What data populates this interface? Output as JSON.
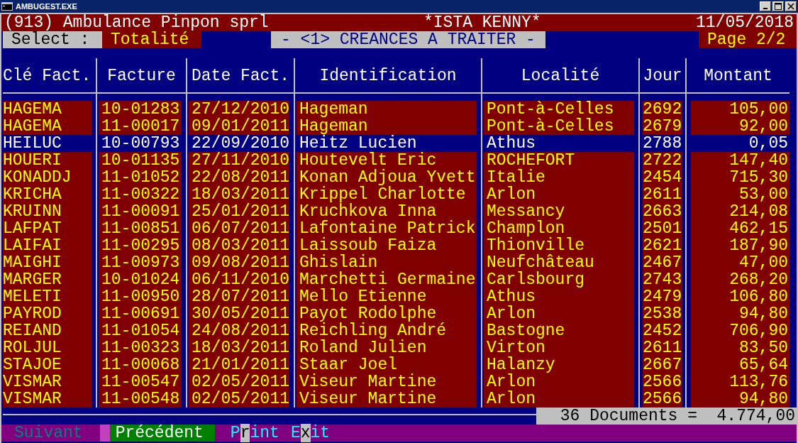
{
  "window": {
    "title": "AMBUGEST.EXE"
  },
  "header": {
    "company": "(913) Ambulance Pinpon sprl",
    "user": "*ISTA KENNY*",
    "date": "11/05/2018"
  },
  "select": {
    "label": "Select :",
    "value": "Totalité"
  },
  "screen_title": "- <1> CREANCES A TRAITER -",
  "page": "Page 2/2",
  "table": {
    "columns": [
      {
        "label": "Clé Fact.",
        "kind": "text"
      },
      {
        "label": "Facture",
        "kind": "text"
      },
      {
        "label": "Date Fact.",
        "kind": "text"
      },
      {
        "label": "Identification",
        "kind": "text"
      },
      {
        "label": "Localité",
        "kind": "text"
      },
      {
        "label": "Jour",
        "kind": "text"
      },
      {
        "label": "Montant",
        "kind": "amount"
      }
    ],
    "rows": [
      {
        "selected": false,
        "cells": [
          "HAGEMA",
          "10-01283",
          "27/12/2010",
          "Hageman",
          "Pont-à-Celles",
          "2692",
          "105,00"
        ]
      },
      {
        "selected": false,
        "cells": [
          "HAGEMA",
          "11-00017",
          "09/01/2011",
          "Hageman",
          "Pont-à-Celles",
          "2679",
          "92,00"
        ]
      },
      {
        "selected": true,
        "cells": [
          "HEILUC",
          "10-00793",
          "22/09/2010",
          "Heitz Lucien",
          "Athus",
          "2788",
          "0,05"
        ]
      },
      {
        "selected": false,
        "cells": [
          "HOUERI",
          "10-01135",
          "27/11/2010",
          "Houtevelt Eric",
          "ROCHEFORT",
          "2722",
          "147,40"
        ]
      },
      {
        "selected": false,
        "cells": [
          "KONADDJ",
          "11-01052",
          "22/08/2011",
          "Konan Adjoua Yvett",
          "Italie",
          "2454",
          "715,30"
        ]
      },
      {
        "selected": false,
        "cells": [
          "KRICHA",
          "11-00322",
          "18/03/2011",
          "Krippel Charlotte",
          "Arlon",
          "2611",
          "53,00"
        ]
      },
      {
        "selected": false,
        "cells": [
          "KRUINN",
          "11-00091",
          "25/01/2011",
          "Kruchkova Inna",
          "Messancy",
          "2663",
          "214,08"
        ]
      },
      {
        "selected": false,
        "cells": [
          "LAFPAT",
          "11-00851",
          "06/07/2011",
          "Lafontaine Patrick",
          "Champlon",
          "2501",
          "462,15"
        ]
      },
      {
        "selected": false,
        "cells": [
          "LAIFAI",
          "11-00295",
          "08/03/2011",
          "Laissoub Faiza",
          "Thionville",
          "2621",
          "187,90"
        ]
      },
      {
        "selected": false,
        "cells": [
          "MAIGHI",
          "11-00973",
          "09/08/2011",
          "Ghislain",
          "Neufchâteau",
          "2467",
          "47,00"
        ]
      },
      {
        "selected": false,
        "cells": [
          "MARGER",
          "10-01024",
          "06/11/2010",
          "Marchetti Germaine",
          "Carlsbourg",
          "2743",
          "268,20"
        ]
      },
      {
        "selected": false,
        "cells": [
          "MELETI",
          "11-00950",
          "28/07/2011",
          "Mello Etienne",
          "Athus",
          "2479",
          "106,80"
        ]
      },
      {
        "selected": false,
        "cells": [
          "PAYROD",
          "11-00691",
          "30/05/2011",
          "Payot Rodolphe",
          "Arlon",
          "2538",
          "94,80"
        ]
      },
      {
        "selected": false,
        "cells": [
          "REIAND",
          "11-01054",
          "24/08/2011",
          "Reichling André",
          "Bastogne",
          "2452",
          "706,90"
        ]
      },
      {
        "selected": false,
        "cells": [
          "ROLJUL",
          "11-00323",
          "18/03/2011",
          "Roland Julien",
          "Virton",
          "2611",
          "83,50"
        ]
      },
      {
        "selected": false,
        "cells": [
          "STAJOE",
          "11-00068",
          "21/01/2011",
          "Staar Joel",
          "Halanzy",
          "2667",
          "65,64"
        ]
      },
      {
        "selected": false,
        "cells": [
          "VISMAR",
          "11-00547",
          "02/05/2011",
          "Viseur Martine",
          "Arlon",
          "2566",
          "113,76"
        ]
      },
      {
        "selected": false,
        "cells": [
          "VISMAR",
          "11-00548",
          "02/05/2011",
          "Viseur Martine",
          "Arlon",
          "2566",
          "94,80"
        ]
      }
    ]
  },
  "summary": {
    "count": "36 Documents =",
    "total": "4.774,00"
  },
  "keys": [
    {
      "before": "Suivant",
      "disabled": true,
      "selected": false
    },
    {
      "before": "Précédent",
      "disabled": false,
      "selected": true
    },
    {
      "before": "P",
      "hotkey": "r",
      "after": "int",
      "disabled": false,
      "selected": false
    },
    {
      "before": "E",
      "hotkey": "x",
      "after": "it",
      "disabled": false,
      "selected": false
    }
  ]
}
